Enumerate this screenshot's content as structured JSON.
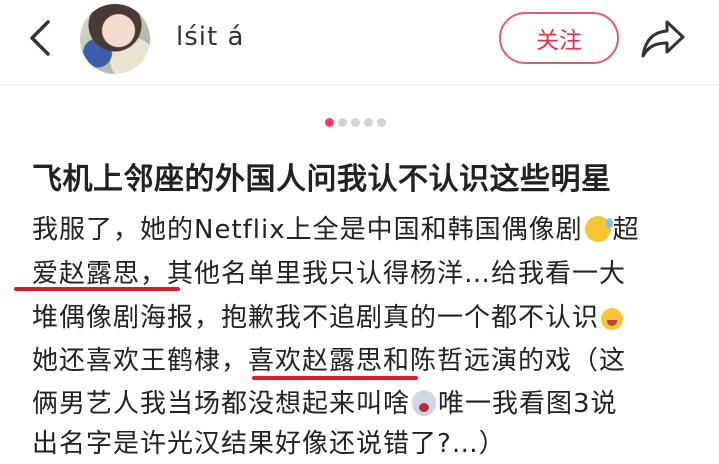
{
  "header": {
    "username": "lśit á",
    "follow_label": "关注"
  },
  "carousel": {
    "count": 5,
    "active": 1
  },
  "post": {
    "title": "飞机上邻座的外国人问我认不认识这些明星",
    "lines": [
      {
        "before": "我服了，她的Netflix上全是中国和韩国偶像剧",
        "emoji": "sweat-smile-icon",
        "after": "超"
      },
      {
        "before": "爱赵露思，其他名单里我只认得杨洋…给我看一大",
        "emoji": "",
        "after": ""
      },
      {
        "before": "堆偶像剧海报，抱歉我不追剧真的一个都不认识",
        "emoji": "crying-icon",
        "after": ""
      },
      {
        "before": "她还喜欢王鹤棣，喜欢赵露思和陈哲远演的戏（这",
        "emoji": "",
        "after": ""
      },
      {
        "before": "俩男艺人我当场都没想起来叫啥",
        "emoji": "scream-icon",
        "after": "唯一我看图3说"
      },
      {
        "before": "出名字是许光汉结果好像还说错了?…）",
        "emoji": "",
        "after": ""
      }
    ]
  },
  "colors": {
    "accent": "#e0344a",
    "underline": "#d91c2b",
    "dot_active": "#f04060"
  }
}
